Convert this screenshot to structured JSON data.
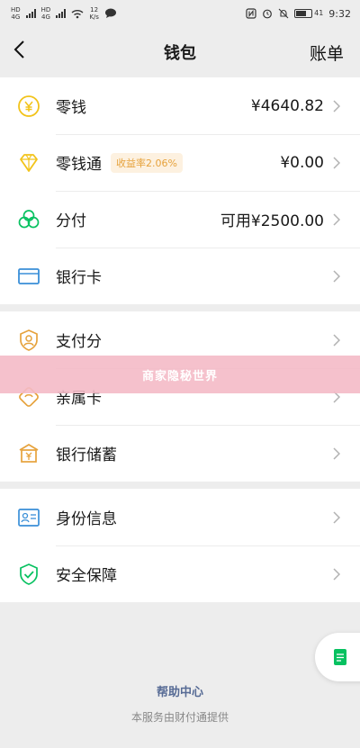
{
  "status_bar": {
    "net1_top": "HD",
    "net1_label": "4G",
    "net2_top": "HD",
    "net2_label": "4G",
    "speed_value": "12",
    "speed_unit": "K/s",
    "battery_level": "41",
    "time": "9:32"
  },
  "nav": {
    "back_icon": "chevron-left-icon",
    "title": "钱包",
    "right": "账单"
  },
  "groups": [
    [
      {
        "id": "lingqian",
        "icon": "yen-coin-icon",
        "label": "零钱",
        "tag": "",
        "value": "¥4640.82"
      },
      {
        "id": "lingqiantong",
        "icon": "diamond-icon",
        "label": "零钱通",
        "tag": "收益率2.06%",
        "value": "¥0.00"
      },
      {
        "id": "fenfu",
        "icon": "clover-icon",
        "label": "分付",
        "tag": "",
        "value": "可用¥2500.00"
      },
      {
        "id": "yinhangka",
        "icon": "bank-card-icon",
        "label": "银行卡",
        "tag": "",
        "value": ""
      }
    ],
    [
      {
        "id": "zhifufen",
        "icon": "shield-person-icon",
        "label": "支付分",
        "tag": "",
        "value": ""
      },
      {
        "id": "qinshuka",
        "icon": "family-card-icon",
        "label": "亲属卡",
        "tag": "",
        "value": ""
      },
      {
        "id": "yinhangchuxu",
        "icon": "savings-box-icon",
        "label": "银行储蓄",
        "tag": "",
        "value": ""
      }
    ],
    [
      {
        "id": "shenfenxinxi",
        "icon": "id-card-icon",
        "label": "身份信息",
        "tag": "",
        "value": ""
      },
      {
        "id": "anquanbaozhang",
        "icon": "shield-check-icon",
        "label": "安全保障",
        "tag": "",
        "value": ""
      }
    ]
  ],
  "watermark": "商家隐秘世界",
  "footer": {
    "help": "帮助中心",
    "note": "本服务由财付通提供"
  },
  "colors": {
    "background": "#ededed",
    "accent_yellow": "#f2c31a",
    "accent_green": "#07c160",
    "accent_blue": "#3a8fd8",
    "accent_orange": "#e6a23c",
    "link_blue": "#576b95",
    "watermark_pink": "#f4bac6"
  }
}
